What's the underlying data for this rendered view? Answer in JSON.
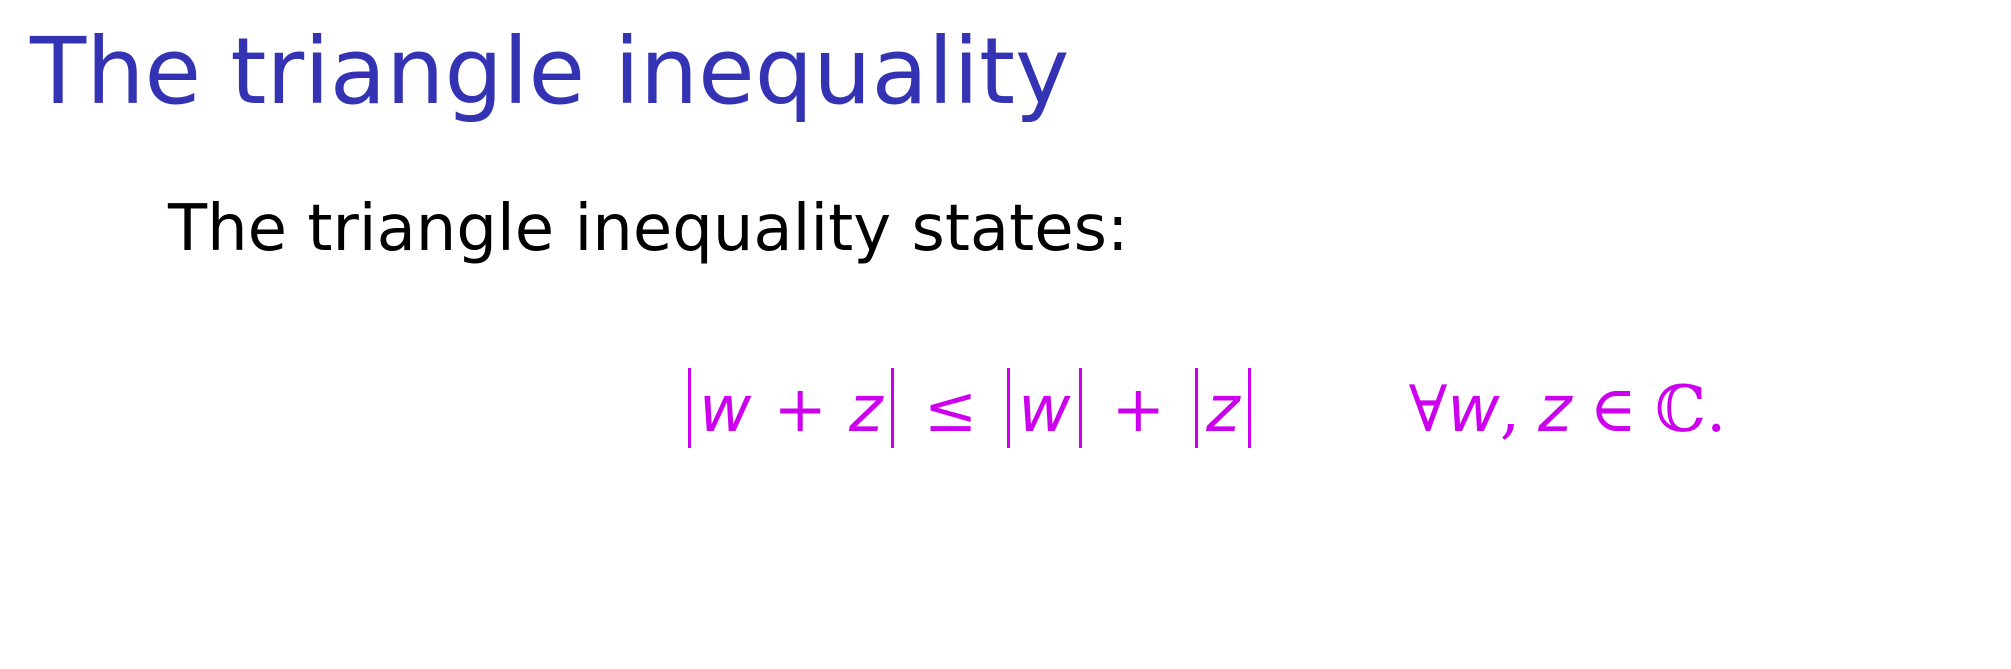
{
  "slide": {
    "title": "The triangle inequality",
    "intro": "The triangle inequality states:"
  },
  "formula": {
    "var_w": "w",
    "var_z": "z",
    "plus": "+",
    "leq": "≤",
    "forall": "∀",
    "comma": ",",
    "element_of": "∈",
    "complex_set": "ℂ",
    "period": "."
  },
  "colors": {
    "title": "#3333b3",
    "text": "#000000",
    "math": "#cc00ee",
    "background": "#ffffff"
  }
}
